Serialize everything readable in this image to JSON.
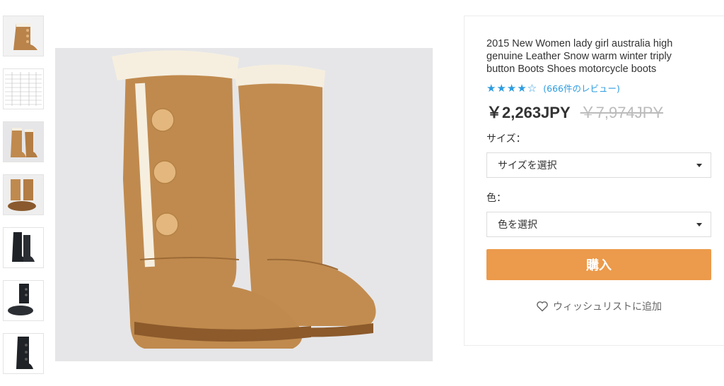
{
  "gallery": {
    "thumbnails": [
      {
        "name": "thumb-boot-side"
      },
      {
        "name": "thumb-size-chart"
      },
      {
        "name": "thumb-boots-front"
      },
      {
        "name": "thumb-boots-sole"
      },
      {
        "name": "thumb-black-boots"
      },
      {
        "name": "thumb-black-boots-sole"
      },
      {
        "name": "thumb-black-boot-side"
      }
    ]
  },
  "product": {
    "title": "2015 New Women lady girl australia high genuine Leather Snow warm winter triply button Boots Shoes motorcycle boots",
    "rating": 4,
    "rating_max": 5,
    "stars_filled": "★★★★",
    "stars_empty": "☆",
    "reviews": "(666件のレビュー)",
    "price": "￥2,263JPY",
    "old_price": "￥7,974JPY"
  },
  "options": {
    "size_label": "サイズ：",
    "size_placeholder": "サイズを選択",
    "color_label": "色：",
    "color_placeholder": "色を選択"
  },
  "actions": {
    "buy_label": "購入",
    "wishlist_label": "ウィッシュリストに追加"
  },
  "colors": {
    "accent_blue": "#2c9ce0",
    "buy_orange": "#ec9a4b",
    "boot_tan": "#c08a4e",
    "fur_cream": "#f6efe0"
  }
}
